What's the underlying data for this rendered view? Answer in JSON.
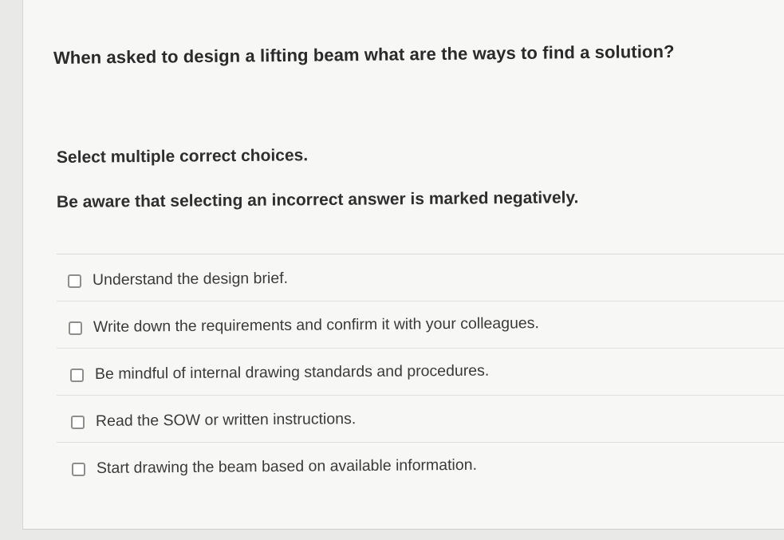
{
  "question": {
    "text": "When asked to design a lifting beam what are the ways to find a solution?"
  },
  "instructions": {
    "select": "Select multiple correct choices.",
    "warning": "Be aware that selecting an incorrect answer is marked negatively."
  },
  "choices": [
    {
      "label": "Understand the design brief.",
      "checked": false
    },
    {
      "label": "Write down the requirements and confirm it with your colleagues.",
      "checked": false
    },
    {
      "label": "Be mindful of internal drawing standards and procedures.",
      "checked": false
    },
    {
      "label": "Read the SOW or written instructions.",
      "checked": false
    },
    {
      "label": "Start drawing the beam based on available information.",
      "checked": false
    }
  ]
}
